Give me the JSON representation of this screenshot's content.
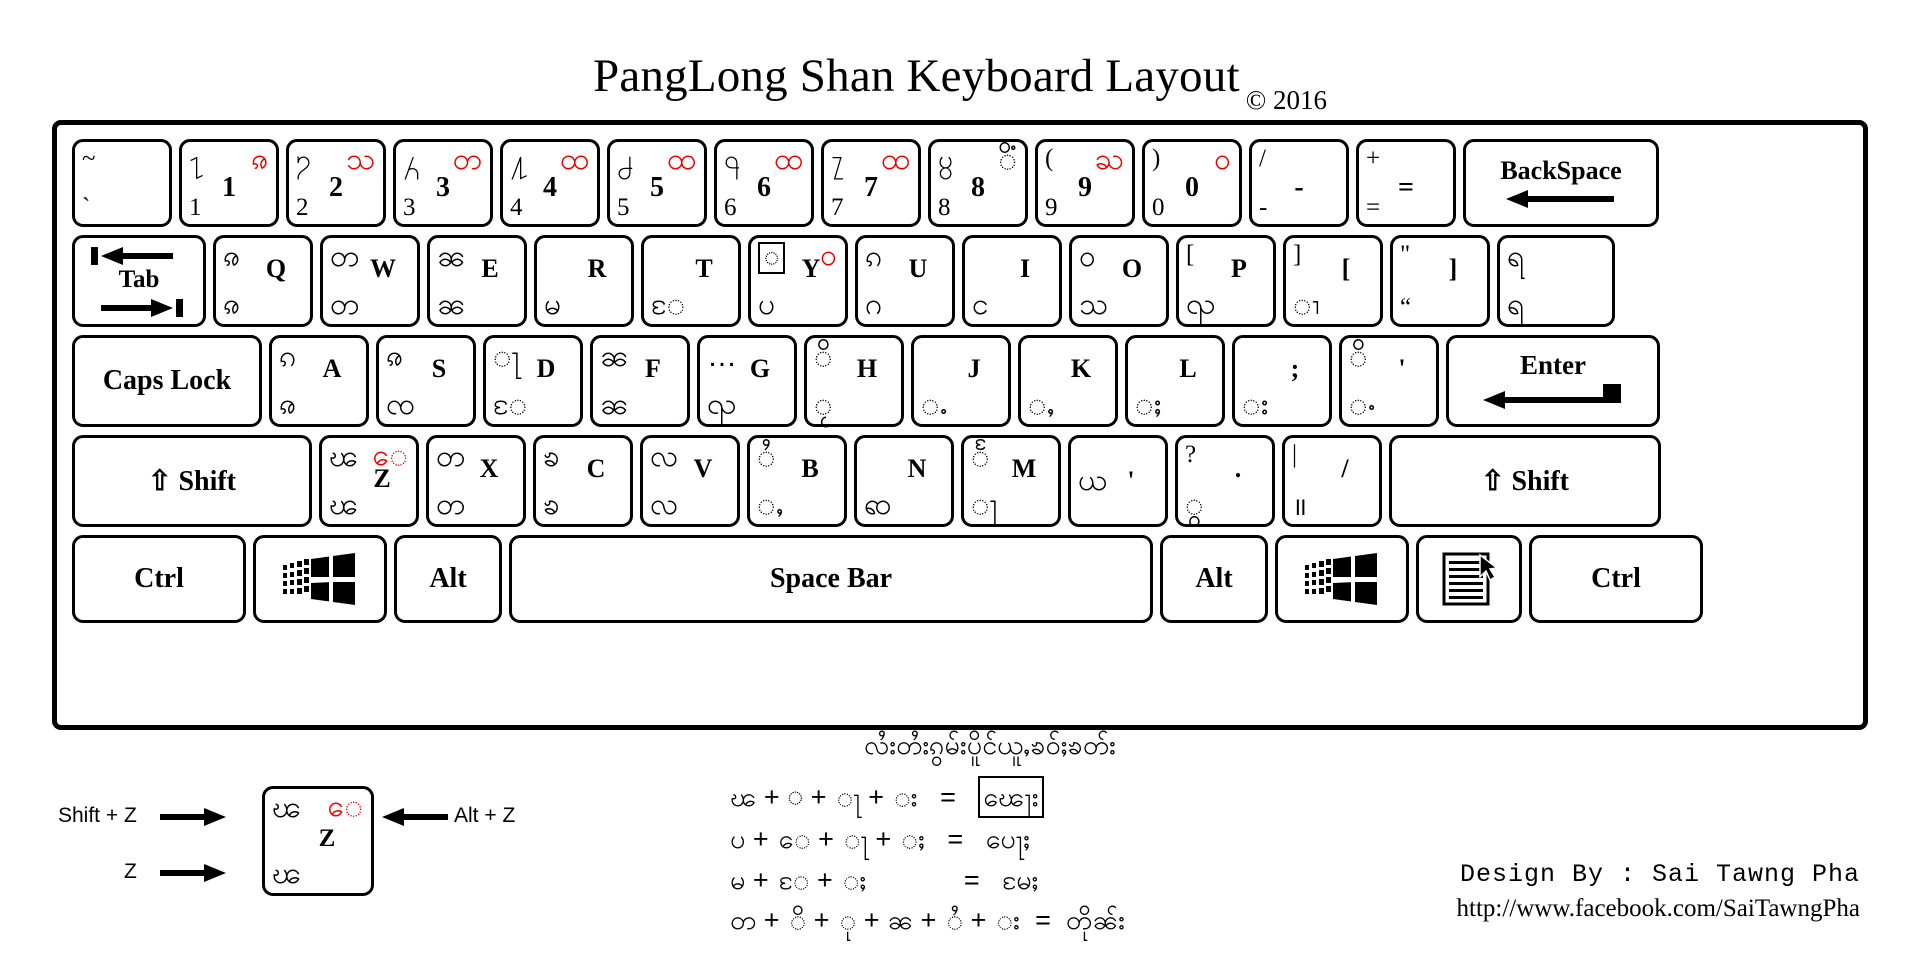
{
  "title": {
    "main": "PangLong Shan Keyboard Layout",
    "copyright": "© 2016"
  },
  "keyboard": {
    "rows": [
      {
        "name": "number-row",
        "keys": [
          {
            "name": "backtick",
            "latin": "",
            "top_left": "~",
            "bottom_left": "`",
            "top_right": "",
            "shan": ""
          },
          {
            "name": "digit-1",
            "latin": "1",
            "top_left": "႑",
            "bottom_left": "1",
            "top_right": "ၷ"
          },
          {
            "name": "digit-2",
            "latin": "2",
            "top_left": "႒",
            "bottom_left": "2",
            "top_right": "သ"
          },
          {
            "name": "digit-3",
            "latin": "3",
            "top_left": "႓",
            "bottom_left": "3",
            "top_right": "တ"
          },
          {
            "name": "digit-4",
            "latin": "4",
            "top_left": "႔",
            "bottom_left": "4",
            "top_right": "ထ"
          },
          {
            "name": "digit-5",
            "latin": "5",
            "top_left": "႕",
            "bottom_left": "5",
            "top_right": "ထ"
          },
          {
            "name": "digit-6",
            "latin": "6",
            "top_left": "႖",
            "bottom_left": "6",
            "top_right": "ထ"
          },
          {
            "name": "digit-7",
            "latin": "7",
            "top_left": "႗",
            "bottom_left": "7",
            "top_right": "ထ"
          },
          {
            "name": "digit-8",
            "latin": "8",
            "top_left": "႘",
            "bottom_left": "8",
            "top_right": "ိံ"
          },
          {
            "name": "digit-9",
            "latin": "9",
            "top_left": "(",
            "bottom_left": "9",
            "top_right": "ႀ"
          },
          {
            "name": "digit-0",
            "latin": "0",
            "top_left": ")",
            "bottom_left": "0",
            "top_right": "၀"
          },
          {
            "name": "minus",
            "latin": "-",
            "top_left": "/",
            "bottom_left": "-",
            "top_right": ""
          },
          {
            "name": "equals",
            "latin": "=",
            "top_left": "+",
            "bottom_left": "=",
            "top_right": ""
          },
          {
            "name": "backspace",
            "label": "BackSpace",
            "icon": "arrow-left-icon"
          }
        ]
      },
      {
        "name": "qwerty-row",
        "keys": [
          {
            "name": "tab",
            "label": "Tab",
            "icon": "tab-arrows-icon"
          },
          {
            "name": "key-q",
            "latin": "Q",
            "top_left": "ၷ",
            "bottom_left": "ၷ"
          },
          {
            "name": "key-w",
            "latin": "W",
            "top_left": "တ",
            "bottom_left": "တ"
          },
          {
            "name": "key-e",
            "latin": "E",
            "top_left": "ၼ",
            "bottom_left": "ၼ"
          },
          {
            "name": "key-r",
            "latin": "R",
            "top_left": "",
            "bottom_left": "မ"
          },
          {
            "name": "key-t",
            "latin": "T",
            "top_left": "",
            "bottom_left": "ႄ"
          },
          {
            "name": "key-y",
            "latin": "Y",
            "top_left": "◌",
            "bottom_left": "ပ",
            "top_right": "ဝ",
            "boxed": true
          },
          {
            "name": "key-u",
            "latin": "U",
            "top_left": "ၵ",
            "bottom_left": "ဂ"
          },
          {
            "name": "key-i",
            "latin": "I",
            "top_left": "",
            "bottom_left": "င"
          },
          {
            "name": "key-o",
            "latin": "O",
            "top_left": "ဝ",
            "bottom_left": "သ"
          },
          {
            "name": "key-p",
            "latin": "P",
            "top_left": "[",
            "bottom_left": "ၺ"
          },
          {
            "name": "bracket-left",
            "latin": "[",
            "top_left": "]",
            "bottom_left": "ၢ"
          },
          {
            "name": "bracket-right",
            "latin": "]",
            "top_left": "\"",
            "bottom_left": "“"
          },
          {
            "name": "backslash",
            "latin": "",
            "top_left": "ရ",
            "bottom_left": "ရ"
          }
        ]
      },
      {
        "name": "home-row",
        "keys": [
          {
            "name": "caps-lock",
            "label": "Caps Lock"
          },
          {
            "name": "key-a",
            "latin": "A",
            "top_left": "ၵ",
            "bottom_left": "ၷ"
          },
          {
            "name": "key-s",
            "latin": "S",
            "top_left": "ၷ",
            "bottom_left": "ၸ"
          },
          {
            "name": "key-d",
            "latin": "D",
            "top_left": "ႃ",
            "bottom_left": "ႄ"
          },
          {
            "name": "key-f",
            "latin": "F",
            "top_left": "ၼ",
            "bottom_left": "ၼ"
          },
          {
            "name": "key-g",
            "latin": "G",
            "top_left": "…",
            "bottom_left": "ၺ"
          },
          {
            "name": "key-h",
            "latin": "H",
            "top_left": "ိ",
            "bottom_left": "ႂ"
          },
          {
            "name": "key-j",
            "latin": "J",
            "top_left": "",
            "bottom_left": "ႉ"
          },
          {
            "name": "key-k",
            "latin": "K",
            "top_left": "",
            "bottom_left": "ႇ"
          },
          {
            "name": "key-l",
            "latin": "L",
            "top_left": "",
            "bottom_left": "ႈ"
          },
          {
            "name": "semicolon",
            "latin": ";",
            "top_left": "",
            "bottom_left": "း"
          },
          {
            "name": "quote",
            "latin": "'",
            "top_left": "ိ",
            "bottom_left": "ႋ"
          },
          {
            "name": "enter",
            "label": "Enter",
            "icon": "enter-arrow-icon"
          }
        ]
      },
      {
        "name": "shift-row",
        "keys": [
          {
            "name": "shift-left",
            "label": "Shift",
            "icon": "shift-up-icon"
          },
          {
            "name": "key-z",
            "latin": "Z",
            "top_left": "ၽ",
            "bottom_left": "ၽ",
            "top_right": "ေ"
          },
          {
            "name": "key-x",
            "latin": "X",
            "top_left": "တ",
            "bottom_left": "တ"
          },
          {
            "name": "key-c",
            "latin": "C",
            "top_left": "ၶ",
            "bottom_left": "ၶ"
          },
          {
            "name": "key-v",
            "latin": "V",
            "top_left": "လ",
            "bottom_left": "လ"
          },
          {
            "name": "key-b",
            "latin": "B",
            "top_left": "ႆ",
            "bottom_left": "ႇ"
          },
          {
            "name": "key-n",
            "latin": "N",
            "top_left": "",
            "bottom_left": "ၹ"
          },
          {
            "name": "key-m",
            "latin": "M",
            "top_left": "ႅ",
            "bottom_left": "ႃ"
          },
          {
            "name": "comma",
            "latin": "'",
            "top_left": "",
            "bottom_left": "ယ"
          },
          {
            "name": "period",
            "latin": ".",
            "top_left": "?",
            "bottom_left": "ွ"
          },
          {
            "name": "slash",
            "latin": "/",
            "top_left": "|",
            "bottom_left": "॥"
          },
          {
            "name": "shift-right",
            "label": "Shift",
            "icon": "shift-up-icon"
          }
        ]
      },
      {
        "name": "bottom-row",
        "keys": [
          {
            "name": "ctrl-left",
            "label": "Ctrl"
          },
          {
            "name": "win-left",
            "label": "",
            "icon": "windows-logo-icon"
          },
          {
            "name": "alt-left",
            "label": "Alt"
          },
          {
            "name": "space-bar",
            "label": "Space Bar"
          },
          {
            "name": "alt-right",
            "label": "Alt"
          },
          {
            "name": "win-right",
            "label": "",
            "icon": "windows-logo-icon"
          },
          {
            "name": "menu-key",
            "label": "",
            "icon": "context-menu-icon"
          },
          {
            "name": "ctrl-right",
            "label": "Ctrl"
          }
        ]
      }
    ]
  },
  "legend": {
    "shift_z_label": "Shift + Z",
    "z_label": "Z",
    "alt_z_label": "Alt + Z",
    "key": {
      "top_left": "ၽ",
      "bottom_left": "ၽ",
      "top_right": "ေ",
      "latin": "Z"
    }
  },
  "compose": {
    "title": "လႆးတႆးၵွမ်းပိူင်ယူႇၶဝ်ႈၶတ်း",
    "rows": [
      {
        "inputs": "ၽ  +  ◌  +  ႃ  +  း",
        "result": "ၽေႃး"
      },
      {
        "inputs": "ပ  +  ေ  +  ႃ  +  ႈ",
        "result": "ပေႃႈ"
      },
      {
        "inputs": "မ  +  ႄ  +  ႈ",
        "result": "မႄႈ"
      },
      {
        "inputs": "တ  +  ိ  +  ု  +  ၼ  +  ႆ  +  း",
        "result": "တိုၼ်း"
      }
    ]
  },
  "footer": {
    "design_by": "Design By : Sai Tawng Pha",
    "url": "http://www.facebook.com/SaiTawngPha"
  },
  "colors": {
    "accent_red": "#ee0000",
    "ink": "#000000",
    "background": "#ffffff"
  }
}
